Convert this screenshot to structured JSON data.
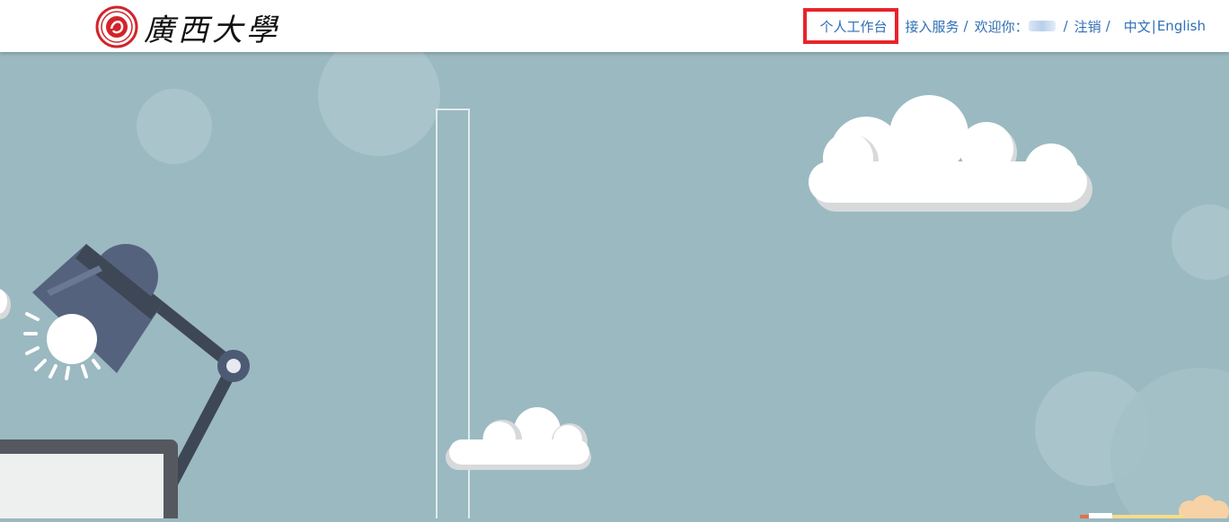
{
  "header": {
    "logo_name": "廣西大學",
    "nav": {
      "workspace": "个人工作台",
      "access_service": "接入服务",
      "separator": "/",
      "welcome": "欢迎你：",
      "logout": "注销",
      "lang_zh": "中文",
      "lang_divider": "|",
      "lang_en": "English"
    }
  },
  "colors": {
    "background": "#9bb9c1",
    "link": "#2f6fb5",
    "highlight_border": "#e8232c",
    "logo_red": "#d2232a"
  },
  "icons": [
    "university-seal-icon",
    "desk-lamp-icon",
    "cloud-icon"
  ]
}
